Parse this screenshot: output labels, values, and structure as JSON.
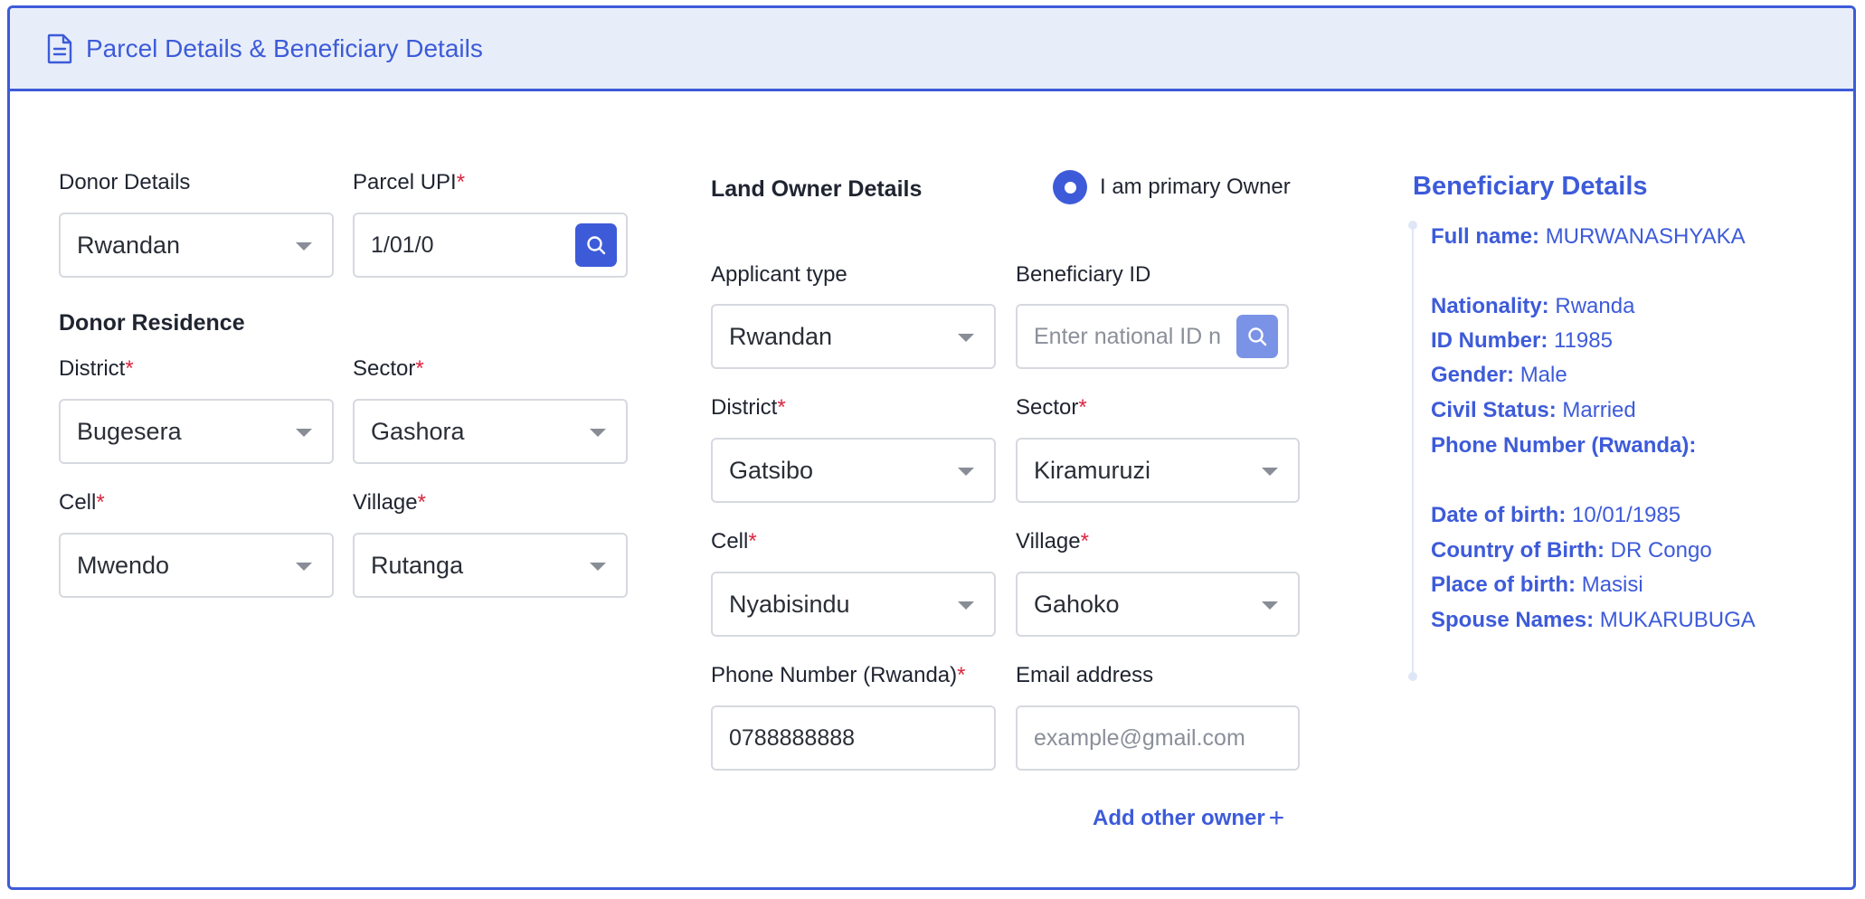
{
  "header": {
    "title": "Parcel Details & Beneficiary Details",
    "icon": "document-icon"
  },
  "donor": {
    "details_label": "Donor Details",
    "details_value": "Rwandan",
    "parcel_upi_label": "Parcel UPI",
    "parcel_upi_value": "1/01/0",
    "residence_heading": "Donor Residence",
    "district_label": "District",
    "district_value": "Bugesera",
    "sector_label": "Sector",
    "sector_value": "Gashora",
    "cell_label": "Cell",
    "cell_value": "Mwendo",
    "village_label": "Village",
    "village_value": "Rutanga"
  },
  "owner": {
    "heading": "Land Owner Details",
    "primary_owner_label": "I am primary Owner",
    "applicant_type_label": "Applicant type",
    "applicant_type_value": "Rwandan",
    "beneficiary_id_label": "Beneficiary ID",
    "beneficiary_id_placeholder": "Enter national ID n",
    "district_label": "District",
    "district_value": "Gatsibo",
    "sector_label": "Sector",
    "sector_value": "Kiramuruzi",
    "cell_label": "Cell",
    "cell_value": "Nyabisindu",
    "village_label": "Village",
    "village_value": "Gahoko",
    "phone_label": "Phone Number (Rwanda)",
    "phone_value": "0788888888",
    "email_label": "Email address",
    "email_placeholder": "example@gmail.com",
    "add_owner_label": "Add other owner",
    "add_owner_plus": "+"
  },
  "required_mark": "*",
  "beneficiary": {
    "title": "Beneficiary Details",
    "rows": [
      {
        "key": "Full name:",
        "value": "MURWANASHYAKA"
      },
      {
        "key": "Nationality:",
        "value": "Rwanda"
      },
      {
        "key": "ID Number:",
        "value": "11985"
      },
      {
        "key": "Gender:",
        "value": "Male"
      },
      {
        "key": "Civil Status:",
        "value": "Married"
      },
      {
        "key": "Phone Number (Rwanda):",
        "value": ""
      },
      {
        "key": "Date of birth:",
        "value": "10/01/1985"
      },
      {
        "key": "Country of Birth:",
        "value": "DR Congo"
      },
      {
        "key": "Place of birth:",
        "value": "Masisi"
      },
      {
        "key": "Spouse Names:",
        "value": "MUKARUBUGA"
      }
    ]
  },
  "colors": {
    "accent": "#3d5bd9",
    "required": "#d9263f",
    "header_bg": "#e8eef9"
  }
}
